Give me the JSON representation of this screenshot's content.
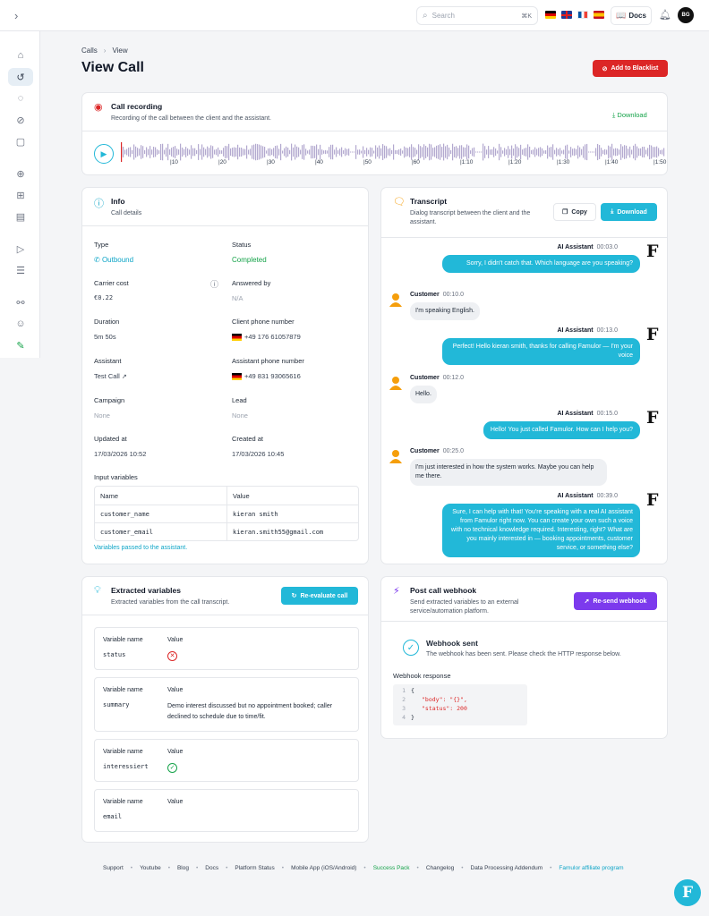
{
  "topbar": {
    "search_placeholder": "Search",
    "search_shortcut": "⌘K",
    "docs_label": "Docs",
    "avatar_initials": "BG",
    "flags": [
      "de",
      "gb",
      "fr",
      "es"
    ]
  },
  "breadcrumb": {
    "items": [
      "Calls",
      "View"
    ],
    "separator": "›"
  },
  "page": {
    "title": "View Call",
    "blacklist_label": "Add to Blacklist"
  },
  "recording": {
    "title": "Call recording",
    "subtitle": "Recording of the call between the client and the assistant.",
    "download_label": "Download",
    "ticks": [
      "|10",
      "|20",
      "|30",
      "|40",
      "|50",
      "|60",
      "|1:10",
      "|1:20",
      "|1:30",
      "|1:40",
      "|1:50"
    ]
  },
  "info": {
    "title": "Info",
    "subtitle": "Call details",
    "fields": {
      "type_label": "Type",
      "type_value": "Outbound",
      "status_label": "Status",
      "status_value": "Completed",
      "carrier_label": "Carrier cost",
      "carrier_value": "€0.22",
      "answered_label": "Answered by",
      "answered_value": "N/A",
      "duration_label": "Duration",
      "duration_value": "5m 50s",
      "client_phone_label": "Client phone number",
      "client_phone_value": "+49 176 61057879",
      "assistant_label": "Assistant",
      "assistant_value": "Test Call",
      "assistant_phone_label": "Assistant phone number",
      "assistant_phone_value": "+49 831 93065616",
      "campaign_label": "Campaign",
      "campaign_value": "None",
      "lead_label": "Lead",
      "lead_value": "None",
      "updated_label": "Updated at",
      "updated_value": "17/03/2026 10:52",
      "created_label": "Created at",
      "created_value": "17/03/2026 10:45"
    },
    "input_vars_label": "Input variables",
    "input_vars_headers": [
      "Name",
      "Value"
    ],
    "input_vars": [
      {
        "name": "customer_name",
        "value": "kieran smith"
      },
      {
        "name": "customer_email",
        "value": "kieran.smith55@gmail.com"
      }
    ],
    "input_vars_note": "Variables passed to the assistant."
  },
  "transcript": {
    "title": "Transcript",
    "subtitle": "Dialog transcript between the client and the assistant.",
    "copy_label": "Copy",
    "download_label": "Download",
    "messages": [
      {
        "speaker": "AI Assistant",
        "time": "00:03.0",
        "text": "Sorry, I didn't catch that. Which language are you speaking?"
      },
      {
        "speaker": "Customer",
        "time": "00:10.0",
        "text": "I'm speaking English."
      },
      {
        "speaker": "AI Assistant",
        "time": "00:13.0",
        "text": "Perfect! Hello kieran smith, thanks for calling Famulor — I'm your voice"
      },
      {
        "speaker": "Customer",
        "time": "00:12.0",
        "text": "Hello."
      },
      {
        "speaker": "AI Assistant",
        "time": "00:15.0",
        "text": "Hello! You just called Famulor. How can I help you?"
      },
      {
        "speaker": "Customer",
        "time": "00:25.0",
        "text": "I'm just interested in how the system works. Maybe you can help me there."
      },
      {
        "speaker": "AI Assistant",
        "time": "00:39.0",
        "text": "Sure, I can help with that! You're speaking with a real AI assistant from Famulor right now. You can create your own such a voice with no technical knowledge required. Interesting, right? What are you mainly interested in — booking appointments, customer service, or something else?"
      }
    ]
  },
  "extracted": {
    "title": "Extracted variables",
    "subtitle": "Extracted variables from the call transcript.",
    "reevaluate_label": "Re-evaluate call",
    "col_name": "Variable name",
    "col_value": "Value",
    "items": [
      {
        "name": "status",
        "value": "",
        "icon": "x-circle-icon"
      },
      {
        "name": "summary",
        "value": "Demo interest discussed but no appointment booked; caller declined to schedule due to time/fit.",
        "icon": ""
      },
      {
        "name": "interessiert",
        "value": "",
        "icon": "check-circle-icon"
      },
      {
        "name": "email",
        "value": "",
        "icon": ""
      }
    ]
  },
  "webhook": {
    "title": "Post call webhook",
    "subtitle": "Send extracted variables to an external service/automation platform.",
    "resend_label": "Re-send webhook",
    "sent_title": "Webhook sent",
    "sent_desc": "The webhook has been sent. Please check the HTTP response below.",
    "response_label": "Webhook response",
    "code_lines": [
      {
        "n": "1",
        "text": "{"
      },
      {
        "n": "2",
        "text": "\"body\": \"{}\","
      },
      {
        "n": "3",
        "text": "\"status\": 200"
      },
      {
        "n": "4",
        "text": "}"
      }
    ]
  },
  "footer": {
    "links": [
      "Support",
      "Youtube",
      "Blog",
      "Docs",
      "Platform Status",
      "Mobile App (iOS/Android)",
      "Success Pack",
      "Changelog",
      "Data Processing Addendum",
      "Famulor affiliate program"
    ]
  },
  "colors": {
    "accent": "#22b8d8",
    "danger": "#dc2626",
    "success": "#16a34a",
    "purple": "#7c3aed"
  }
}
